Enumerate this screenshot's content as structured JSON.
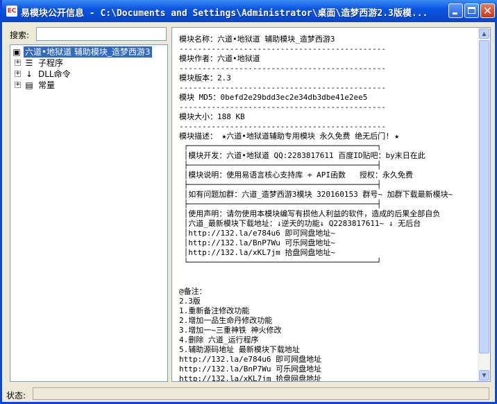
{
  "window": {
    "title": "易模块公开信息 - C:\\Documents and Settings\\Administrator\\桌面\\造梦西游2.3版模...",
    "icon": "app-icon",
    "accent": "#0b55e3"
  },
  "search": {
    "label": "搜索:",
    "value": "",
    "placeholder": ""
  },
  "tree": {
    "nodes": [
      {
        "label": "六道•地狱道 辅助模块_造梦西游3",
        "icon": "module-icon",
        "expander": "",
        "selected": true
      },
      {
        "label": "子程序",
        "icon": "subroutine-icon",
        "expander": "+"
      },
      {
        "label": "DLL命令",
        "icon": "dll-command-icon",
        "expander": "+"
      },
      {
        "label": "常量",
        "icon": "constant-icon",
        "expander": "+"
      }
    ]
  },
  "content": {
    "lines": [
      "模块名称：六道•地狱道 辅助模块_造梦西游3",
      "---------------------------------------------",
      "模块作者：六道•地狱道",
      "---------------------------------------------",
      "模块版本：2.3",
      "---------------------------------------------",
      "模块 MD5：0befd2e29bdd3ec2e34db3dbe41e2ee5",
      "---------------------------------------------",
      "模块大小：188 KB",
      "---------------------------------------------",
      "模块描述： ★六道•地狱道辅助专用模块 永久免费 绝无后门! ★",
      " ┌─────────────────────────────────────────┐",
      " │模块开发：六道•地狱道 QQ:2283817611 百度ID贴吧：by末日在此",
      " ├─────────────────────────────────────────┤",
      " │模块说明：使用易语言核心支持库 + API函数   授权：永久免费",
      " ├─────────────────────────────────────────┤",
      " │如有问题加群：六道_造梦西游3模块 320160153 群号~ 加群下载最新模块~",
      " ├─────────────────────────────────────────┤",
      " │使用声明：请勿使用本模块编写有损他人利益的软件，造成的后果全部自负",
      " │六道_最新模块下载地址：↓逆天的功能↓ Q2283817611~ ↓ 无后台",
      " │http://132.la/e784u6 即可网盘地址~",
      " │http://132.la/BnP7Wu 可乐网盘地址~",
      " │http://132.la/xKL7jm 拾盘网盘地址~",
      " └─────────────────────────────────────────┘",
      "",
      "",
      "@备注：",
      "2.3版",
      "1.重新备注修改功能",
      "2.增加一品生命丹修改功能",
      "3.增加一~三重神铁 神火修改",
      "4.删除 六道_运行程序",
      "5.辅助源码地址 最新模块下载地址",
      "http://132.la/e784u6 即可网盘地址",
      "http://132.la/BnP7Wu 可乐网盘地址",
      "http://132.la/xKL7jm 拾盘网盘地址"
    ]
  },
  "statusbar": {
    "label": "状态:",
    "value": ""
  }
}
